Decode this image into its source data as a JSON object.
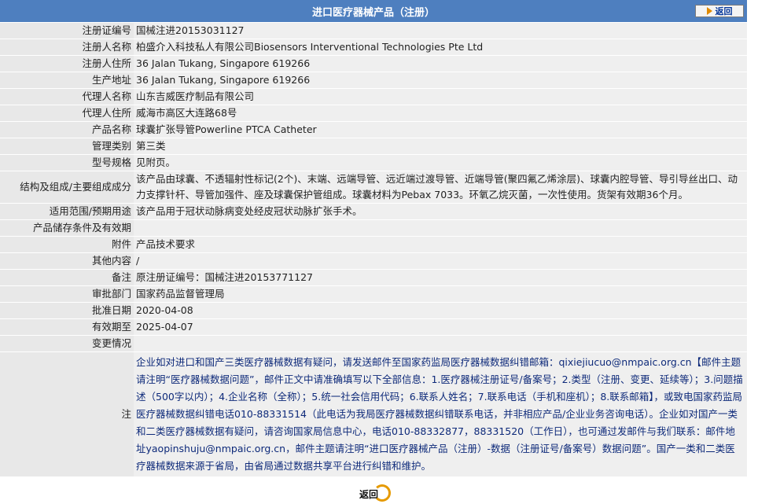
{
  "header": {
    "title": "进口医疗器械产品（注册）",
    "back_label": "返回"
  },
  "rows": [
    {
      "label": "注册证编号",
      "value": "国械注进20153031127"
    },
    {
      "label": "注册人名称",
      "value": "柏盛介入科技私人有限公司Biosensors Interventional Technologies Pte Ltd"
    },
    {
      "label": "注册人住所",
      "value": "36 Jalan Tukang, Singapore 619266"
    },
    {
      "label": "生产地址",
      "value": "36 Jalan Tukang, Singapore 619266"
    },
    {
      "label": "代理人名称",
      "value": "山东吉威医疗制品有限公司"
    },
    {
      "label": "代理人住所",
      "value": "威海市高区大连路68号"
    },
    {
      "label": "产品名称",
      "value": "球囊扩张导管Powerline PTCA Catheter"
    },
    {
      "label": "管理类别",
      "value": "第三类"
    },
    {
      "label": "型号规格",
      "value": "见附页。"
    },
    {
      "label": "结构及组成/主要组成成分",
      "value": "该产品由球囊、不透辐射性标记(2个)、末端、远端导管、远近端过渡导管、近端导管(聚四氟乙烯涂层)、球囊内腔导管、导引导丝出口、动力支撑针杆、导管加强件、座及球囊保护管组成。球囊材料为Pebax 7033。环氧乙烷灭菌，一次性使用。货架有效期36个月。"
    },
    {
      "label": "适用范围/预期用途",
      "value": "该产品用于冠状动脉病变处经皮冠状动脉扩张手术。"
    },
    {
      "label": "产品储存条件及有效期",
      "value": ""
    },
    {
      "label": "附件",
      "value": "产品技术要求"
    },
    {
      "label": "其他内容",
      "value": "/"
    },
    {
      "label": "备注",
      "value": "原注册证编号：国械注进20153771127"
    },
    {
      "label": "审批部门",
      "value": "国家药品监督管理局"
    },
    {
      "label": "批准日期",
      "value": "2020-04-08"
    },
    {
      "label": "有效期至",
      "value": "2025-04-07"
    },
    {
      "label": "变更情况",
      "value": ""
    }
  ],
  "note": {
    "label": "注",
    "text": "企业如对进口和国产三类医疗器械数据有疑问，请发送邮件至国家药监局医疗器械数据纠错邮箱：qixiejiucuo@nmpaic.org.cn【邮件主题请注明“医疗器械数据问题”，邮件正文中请准确填写以下全部信息：1.医疗器械注册证号/备案号；2.类型（注册、变更、延续等）；3.问题描述（500字以内）；4.企业名称（全称）；5.统一社会信用代码；6.联系人姓名；7.联系电话（手机和座机）；8.联系邮箱】，或致电国家药监局医疗器械数据纠错电话010-88331514（此电话为我局医疗器械数据纠错联系电话，并非相应产品/企业业务咨询电话）。企业如对国产一类和二类医疗器械数据有疑问，请咨询国家局信息中心，电话010-88332877，88331520（工作日），也可通过发邮件与我们联系：邮件地址yaopinshuju@nmpaic.org.cn，邮件主题请注明“进口医疗器械产品（注册）-数据（注册证号/备案号）数据问题”。国产一类和二类医疗器械数据来源于省局，由省局通过数据共享平台进行纠错和维护。"
  },
  "footer": {
    "back_label": "返回"
  },
  "colors": {
    "header_bg": "#4e7fbf",
    "label_bg": "#e8e8e8",
    "value_bg": "#efefef",
    "note_text": "#0e2a7a",
    "back_icon": "#e69a00"
  }
}
